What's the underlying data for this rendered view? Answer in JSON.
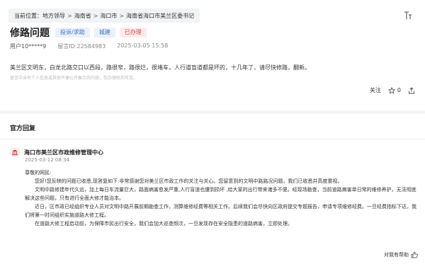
{
  "breadcrumb": {
    "current_label": "当前位置：",
    "items": [
      "地方领导",
      "海南省",
      "海口市",
      "海南省海口市美兰区委书记"
    ],
    "separator": ">"
  },
  "header": {
    "title": "修路问题",
    "tags": [
      {
        "label": "投诉/求助",
        "color": "blue"
      },
      {
        "label": "城建",
        "color": "blue"
      },
      {
        "label": "已办理",
        "color": "red"
      }
    ]
  },
  "meta": {
    "user": "用户10*****9",
    "message_id": "留言ID:22584983",
    "datetime": "2025-03-05 15:58"
  },
  "question": {
    "text": "美兰区文明东，白龙北路交口以西段，路很窄，路很烂，很堵车，人行道盲道都是坏的，十几年了，请尽快修路，翻新。",
    "disclaimer": "留言中含有个人信息或其他不便公开展示的内容，仅办理机构可见。"
  },
  "actions": {
    "follow": "关注",
    "like_count": "0",
    "share_icon": "share-icon",
    "like_icon": "thumbs-up-icon"
  },
  "reply_section": {
    "title": "官方回复",
    "org_icon": "government-building-icon",
    "org_name": "海口市美兰区市政维修管理中心",
    "date": "2025-03-12 08:34",
    "greeting": "尊敬的网民:",
    "paragraphs": [
      "您好!您反映的问题已收悉,现答复如下:非常感谢您对美兰区市政工作的关注与关心。您留意到的文明中路路况问题，我们已收悉并高度重视。",
      "文明中路修建年代久远，加上每日车流量巨大，路面病害愈发严重,人行盲道也遭到损坏 ,给大家的出行带来诸多不便。经现场勘查，当前道路病害单日常的维修养护，无法彻底解决这些问题，只有进行全面大修才能治本。",
      "近日，区市政已经组织专业人员对文明中路开展前期勘查工作，测算维修经费等相关工作。后续我们会尽快向区政府提交专题报告，申请专项维修经费。一旦经费指标下达，我们将第一时间组织实施道路大修工程。",
      "在道路大修工程启动前，为保障市民出行安全，我们会加大巡查频次，一旦发现存在安全隐患的道路病害，立即处理。"
    ],
    "helpful_label": "对我有帮助",
    "helpful_icon": "thumbs-up-icon"
  }
}
